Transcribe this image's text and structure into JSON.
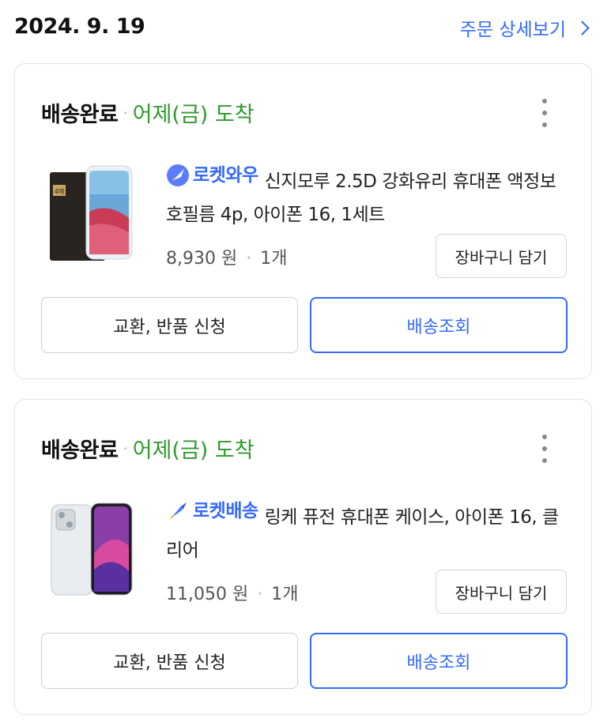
{
  "header": {
    "date": "2024. 9. 19",
    "detail_link": "주문 상세보기"
  },
  "orders": [
    {
      "status": "배송완료",
      "arrival": "어제(금) 도착",
      "badge": "로켓와우",
      "badge_icon": "rocket-icon",
      "title": "신지모루 2.5D 강화유리 휴대폰 액정보호필름 4p, 아이폰 16, 1세트",
      "price": "8,930 원",
      "quantity": "1개",
      "cart_button": "장바구니 담기",
      "exchange_button": "교환, 반품 신청",
      "track_button": "배송조회",
      "thumb_label": "4매",
      "accent_color": "#346aff"
    },
    {
      "status": "배송완료",
      "arrival": "어제(금) 도착",
      "badge": "로켓배송",
      "badge_icon": "rocket-icon",
      "title": "링케 퓨전 휴대폰 케이스, 아이폰 16, 클리어",
      "price": "11,050 원",
      "quantity": "1개",
      "cart_button": "장바구니 담기",
      "exchange_button": "교환, 반품 신청",
      "track_button": "배송조회",
      "accent_color": "#346aff"
    }
  ],
  "colors": {
    "link_blue": "#346aff",
    "arrival_green": "#2f9a2c"
  }
}
